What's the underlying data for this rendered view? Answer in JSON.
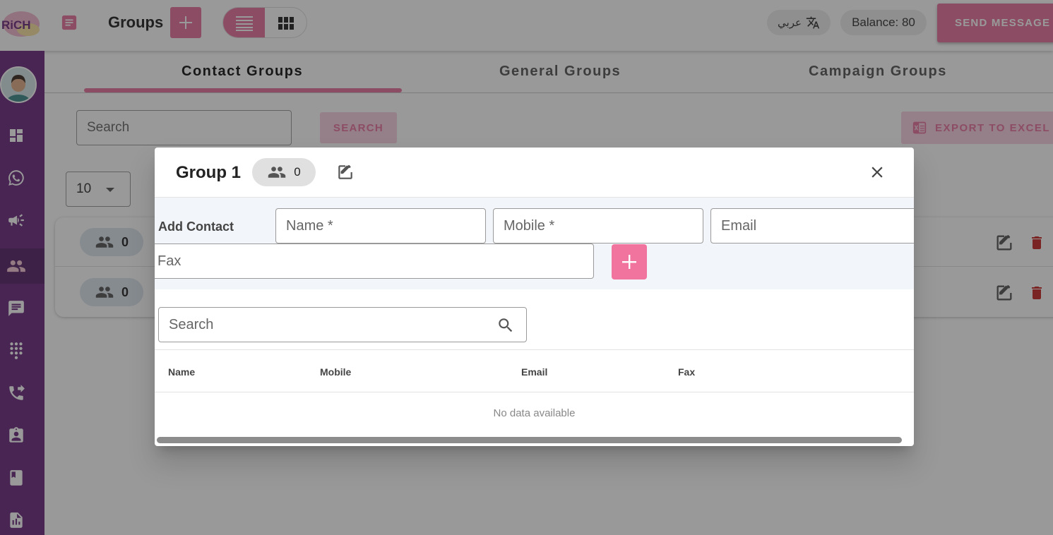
{
  "header": {
    "logo_text": "RiCH",
    "title": "Groups",
    "lang_label": "عربي",
    "balance": "Balance: 80",
    "send_label": "SEND MESSAGE"
  },
  "tabs": [
    {
      "label": "Contact Groups"
    },
    {
      "label": "General Groups"
    },
    {
      "label": "Campaign Groups"
    }
  ],
  "toolbar": {
    "search_placeholder": "Search",
    "search_label": "SEARCH",
    "export_label": "EXPORT TO EXCEL",
    "per_page": "10"
  },
  "groups": [
    {
      "count": "0"
    },
    {
      "count": "0"
    }
  ],
  "dialog": {
    "title": "Group 1",
    "count": "0",
    "add_label": "Add Contact",
    "fields": {
      "name": "Name *",
      "mobile": "Mobile *",
      "email": "Email",
      "fax": "Fax"
    },
    "search_placeholder": "Search",
    "columns": [
      "Name",
      "Mobile",
      "Email",
      "Fax"
    ],
    "empty_text": "No data available"
  },
  "colors": {
    "accent": "#e8739e",
    "sidebar": "#6b2a7e",
    "delete": "#c62828"
  },
  "icons": {
    "sidebar": [
      "dashboard-icon",
      "whatsapp-icon",
      "megaphone-icon",
      "groups-icon",
      "chat-icon",
      "dialpad-icon",
      "phone-forward-icon",
      "clipboard-icon",
      "book-icon",
      "report-icon"
    ]
  }
}
